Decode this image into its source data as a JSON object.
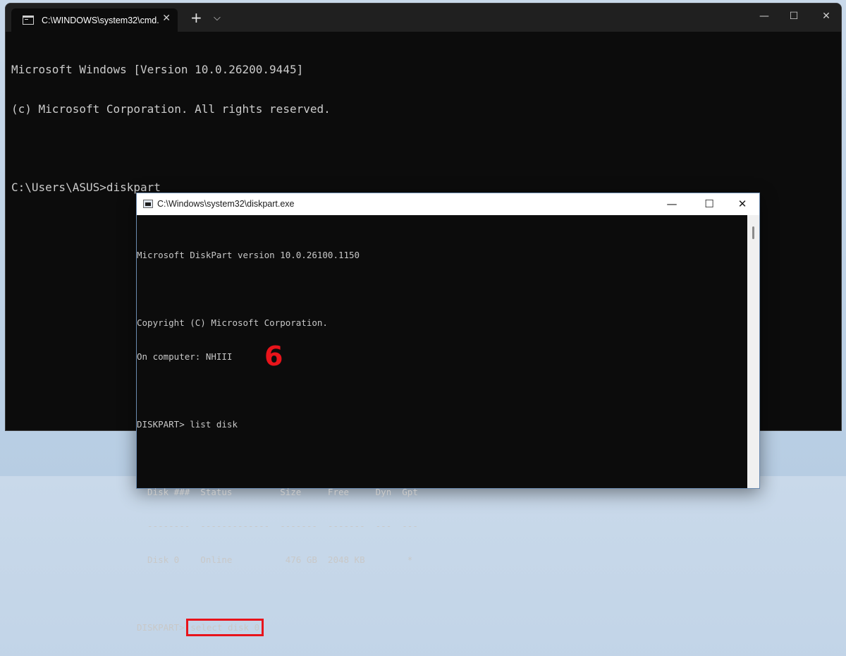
{
  "terminal": {
    "tab_title": "C:\\WINDOWS\\system32\\cmd.",
    "tab_close": "✕",
    "new_tab": "+",
    "dropdown": "⌵",
    "minimize": "—",
    "maximize": "☐",
    "close": "✕",
    "lines": [
      "Microsoft Windows [Version 10.0.26200.9445]",
      "(c) Microsoft Corporation. All rights reserved.",
      "",
      "C:\\Users\\ASUS>diskpart"
    ]
  },
  "diskpart": {
    "title": "C:\\Windows\\system32\\diskpart.exe",
    "minimize": "—",
    "maximize": "☐",
    "close": "✕",
    "version_line": "Microsoft DiskPart version 10.0.26100.1150",
    "copyright_line": "Copyright (C) Microsoft Corporation.",
    "computer_line": "On computer: NHIII",
    "prompt1": "DISKPART> list disk",
    "table_header": "  Disk ###  Status         Size     Free     Dyn  Gpt",
    "table_sep": "  --------  -------------  -------  -------  ---  ---",
    "table_row": "  Disk 0    Online          476 GB  2048 KB        *",
    "prompt2_label": "DISKPART> ",
    "prompt2_cmd": "select disk 0"
  },
  "annotation": {
    "step_number": "6",
    "highlight_color": "#e8141b"
  }
}
